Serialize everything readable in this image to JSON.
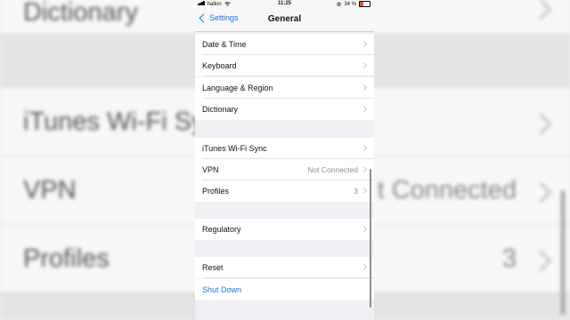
{
  "status_bar": {
    "carrier": "hallon",
    "time": "11:25",
    "battery": "34 %",
    "battery_fraction": 0.34,
    "battery_color": "#e74c3c"
  },
  "nav": {
    "back_label": "Settings",
    "title": "General"
  },
  "rows": {
    "date_time": "Date & Time",
    "keyboard": "Keyboard",
    "language_region": "Language & Region",
    "dictionary": "Dictionary",
    "itunes_wifi_sync": "iTunes Wi-Fi Sync",
    "vpn": "VPN",
    "vpn_value": "Not Connected",
    "profiles": "Profiles",
    "profiles_value": "3",
    "regulatory": "Regulatory",
    "reset": "Reset",
    "shut_down": "Shut Down"
  },
  "background_copy": {
    "dictionary": "Dictionary",
    "itunes": "iTunes Wi-Fi Sy",
    "vpn": "VPN",
    "vpn_value": "t Connected",
    "profiles": "Profiles",
    "profiles_value": "3"
  },
  "colors": {
    "accent": "#1a73e8",
    "grouped_background": "#efeff4",
    "cell": "#ffffff",
    "secondary_text": "#8e8e93"
  },
  "icons": [
    "wifi-icon",
    "signal-icon",
    "alarm-icon",
    "battery-icon",
    "back-chevron-icon",
    "chevron-right-icon"
  ]
}
